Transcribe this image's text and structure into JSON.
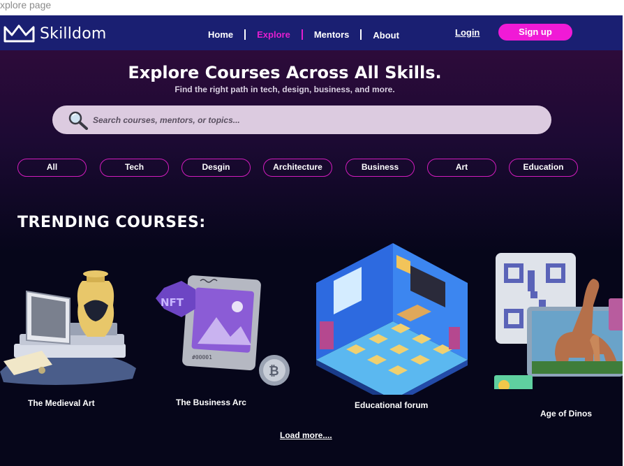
{
  "tab_label": "xplore page",
  "brand": {
    "name": "Skilldom",
    "icon": "crown-icon"
  },
  "nav": {
    "items": [
      {
        "label": "Home",
        "active": false
      },
      {
        "label": "Explore",
        "active": true
      },
      {
        "label": "Mentors",
        "active": false
      },
      {
        "label": "About",
        "active": false
      }
    ],
    "login": "Login",
    "signup": "Sign up"
  },
  "hero": {
    "title": "Explore Courses Across All Skills.",
    "subtitle": "Find the right path in tech, design, business, and more.",
    "search_placeholder": "Search courses, mentors, or topics...",
    "search_icon": "magnifier-icon"
  },
  "categories": [
    "All",
    "Tech",
    "Desgin",
    "Architecture",
    "Business",
    "Art",
    "Education"
  ],
  "trending": {
    "title": "TRENDING COURSES:",
    "courses": [
      {
        "title": "The Medieval Art"
      },
      {
        "title": "The Business Arc"
      },
      {
        "title": "Educational forum"
      },
      {
        "title": "Age of Dinos"
      }
    ],
    "load_more": "Load more...."
  },
  "colors": {
    "navbar": "#1a1f72",
    "accent_pink": "#f01ad6",
    "chip_border": "#d21cbd",
    "background": "#06061a"
  }
}
